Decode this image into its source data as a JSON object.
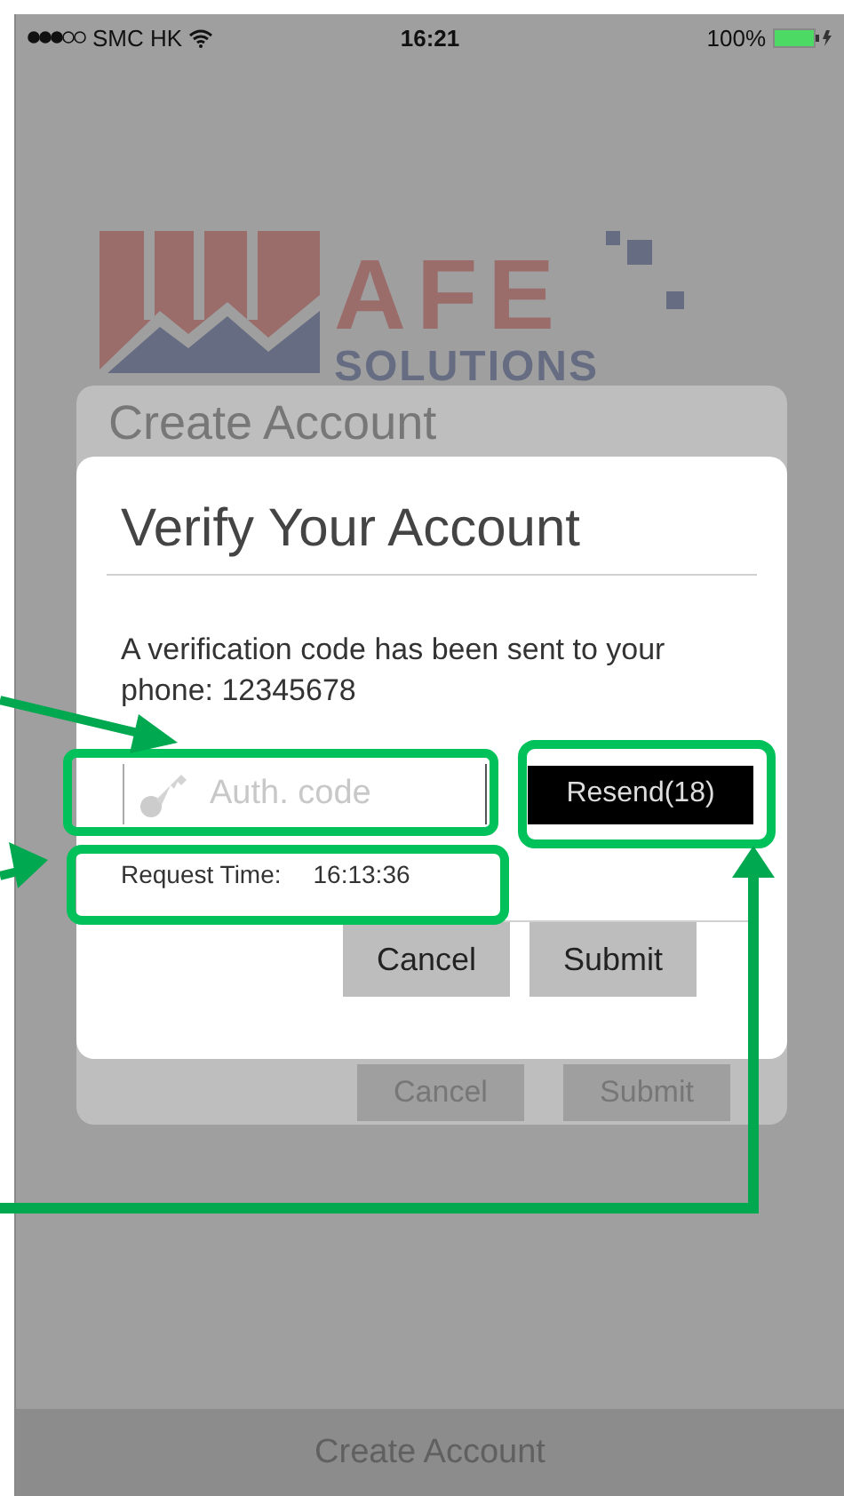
{
  "status_bar": {
    "carrier": "SMC HK",
    "time": "16:21",
    "battery": "100%"
  },
  "logo": {
    "wordmark": "AFE",
    "tagline": "SOLUTIONS"
  },
  "background_form": {
    "title": "Create Account",
    "buttons": [
      "Cancel",
      "Submit"
    ]
  },
  "dialog": {
    "title": "Verify Your Account",
    "message": "A verification code has been sent to your phone: 12345678",
    "auth_field": {
      "placeholder": "Auth. code"
    },
    "resend_button": "Resend(18)",
    "request_time": {
      "label": "Request Time:",
      "value": "16:13:36"
    },
    "buttons": [
      "Cancel",
      "Submit"
    ]
  },
  "bottom_bar": {
    "label": "Create Account"
  }
}
